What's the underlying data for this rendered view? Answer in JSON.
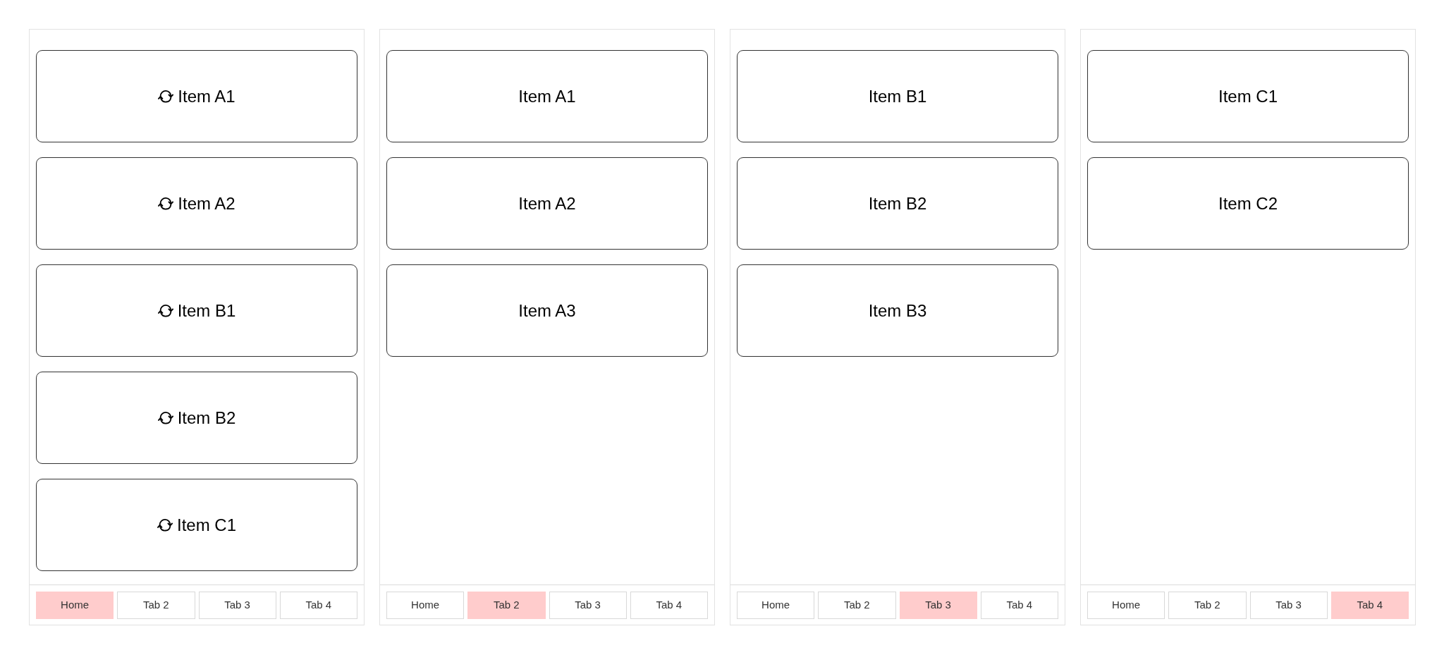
{
  "screens": [
    {
      "items": [
        {
          "label": "Item A1",
          "kind": "sync"
        },
        {
          "label": "Item A2",
          "kind": "sync"
        },
        {
          "label": "Item B1",
          "kind": "sync"
        },
        {
          "label": "Item B2",
          "kind": "sync"
        },
        {
          "label": "Item C1",
          "kind": "sync"
        }
      ],
      "tabs": [
        {
          "label": "Home",
          "selected": true
        },
        {
          "label": "Tab 2",
          "selected": false
        },
        {
          "label": "Tab 3",
          "selected": false
        },
        {
          "label": "Tab 4",
          "selected": false
        }
      ]
    },
    {
      "items": [
        {
          "label": "Item A1",
          "kind": "plain"
        },
        {
          "label": "Item A2",
          "kind": "plain"
        },
        {
          "label": "Item A3",
          "kind": "plain"
        }
      ],
      "tabs": [
        {
          "label": "Home",
          "selected": false
        },
        {
          "label": "Tab 2",
          "selected": true
        },
        {
          "label": "Tab 3",
          "selected": false
        },
        {
          "label": "Tab 4",
          "selected": false
        }
      ]
    },
    {
      "items": [
        {
          "label": "Item B1",
          "kind": "plain"
        },
        {
          "label": "Item B2",
          "kind": "plain"
        },
        {
          "label": "Item B3",
          "kind": "plain"
        }
      ],
      "tabs": [
        {
          "label": "Home",
          "selected": false
        },
        {
          "label": "Tab 2",
          "selected": false
        },
        {
          "label": "Tab 3",
          "selected": true
        },
        {
          "label": "Tab 4",
          "selected": false
        }
      ]
    },
    {
      "items": [
        {
          "label": "Item C1",
          "kind": "plain"
        },
        {
          "label": "Item C2",
          "kind": "plain"
        }
      ],
      "tabs": [
        {
          "label": "Home",
          "selected": false
        },
        {
          "label": "Tab 2",
          "selected": false
        },
        {
          "label": "Tab 3",
          "selected": false
        },
        {
          "label": "Tab 4",
          "selected": true
        }
      ]
    }
  ]
}
